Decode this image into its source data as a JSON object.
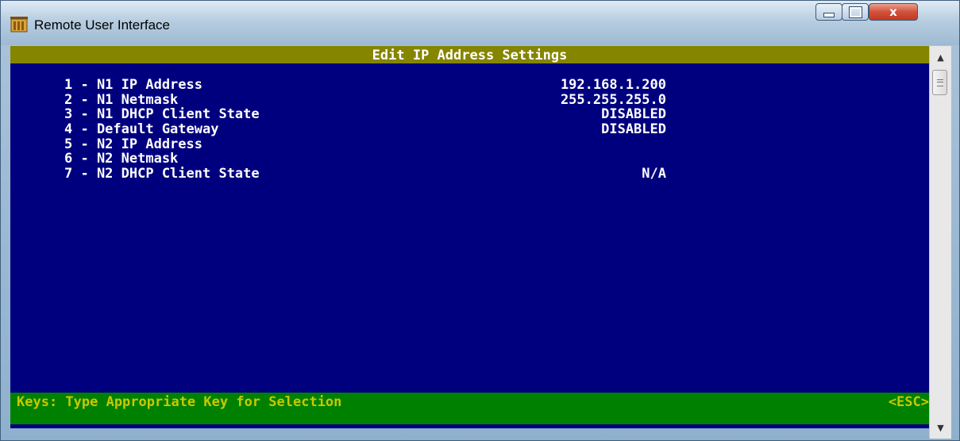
{
  "window": {
    "title": "Remote User Interface",
    "close_glyph": "x"
  },
  "screen": {
    "header": "Edit IP Address Settings",
    "items": [
      {
        "label": "1 - N1 IP Address",
        "value": "192.168.1.200"
      },
      {
        "label": "2 - N1 Netmask",
        "value": "255.255.255.0"
      },
      {
        "label": "3 - N1 DHCP Client State",
        "value": "DISABLED"
      },
      {
        "label": "4 - Default Gateway",
        "value": "DISABLED"
      },
      {
        "label": "5 - N2 IP Address",
        "value": ""
      },
      {
        "label": "6 - N2 Netmask",
        "value": ""
      },
      {
        "label": "7 - N2 DHCP Client State",
        "value": "N/A"
      }
    ],
    "footer": {
      "keys_text": "Keys: Type Appropriate Key for Selection",
      "esc_text": "<ESC>"
    }
  },
  "colors": {
    "background": "#00007f",
    "header_bar": "#858500",
    "footer_bar": "#008000",
    "footer_text": "#c8c800"
  }
}
